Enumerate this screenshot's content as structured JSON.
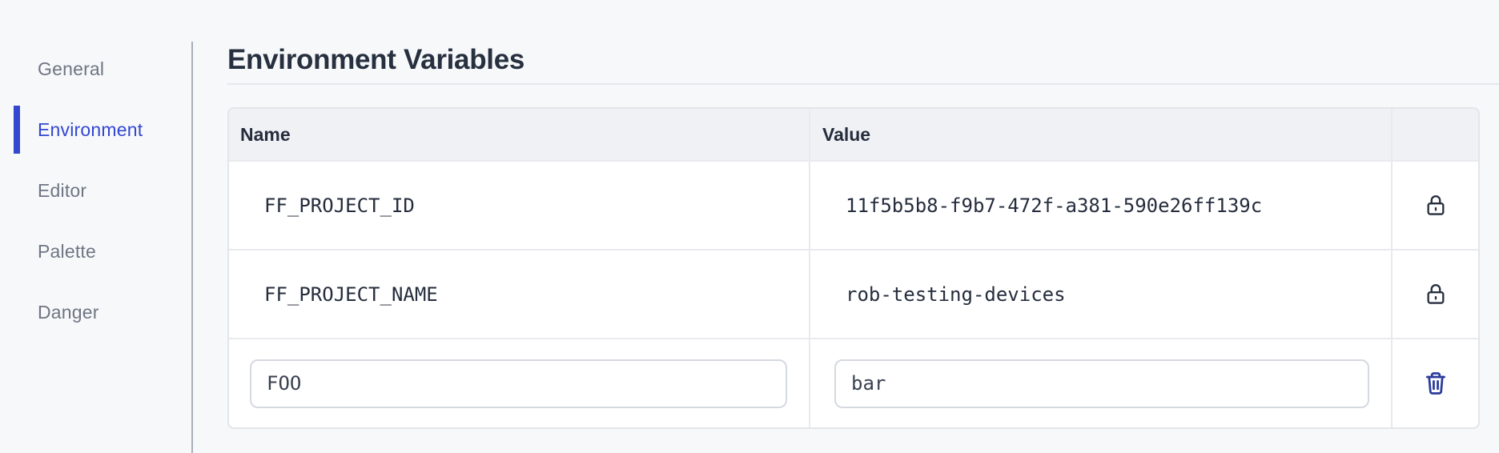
{
  "sidebar": {
    "items": [
      {
        "label": "General",
        "active": false
      },
      {
        "label": "Environment",
        "active": true
      },
      {
        "label": "Editor",
        "active": false
      },
      {
        "label": "Palette",
        "active": false
      },
      {
        "label": "Danger",
        "active": false
      }
    ]
  },
  "main": {
    "title": "Environment Variables",
    "table": {
      "columns": {
        "name": "Name",
        "value": "Value",
        "actions": ""
      },
      "rows": [
        {
          "name": "FF_PROJECT_ID",
          "value": "11f5b5b8-f9b7-472f-a381-590e26ff139c",
          "locked": true
        },
        {
          "name": "FF_PROJECT_NAME",
          "value": "rob-testing-devices",
          "locked": true
        }
      ],
      "editable_row": {
        "name_value": "FOO",
        "value_value": "bar",
        "action": "delete"
      }
    }
  },
  "icons": {
    "lock": "lock-icon",
    "trash": "trash-icon"
  },
  "colors": {
    "accent_blue": "#3347d1",
    "trash_blue": "#2c3c9c",
    "dark_text": "#252d3d",
    "gray_text": "#6e7683",
    "page_bg": "#f7f8fa",
    "table_header_bg": "#eff1f4"
  }
}
